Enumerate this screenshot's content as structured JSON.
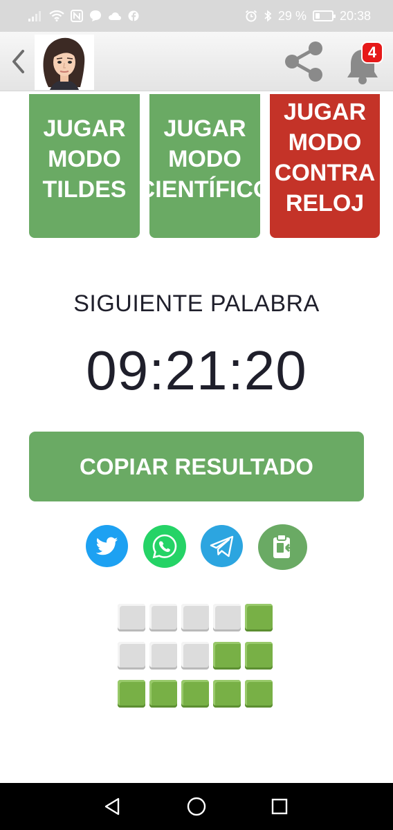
{
  "status_bar": {
    "battery_percent": "29 %",
    "battery_level": 0.29,
    "time": "20:38",
    "left_icons": [
      "signal-icon",
      "wifi-icon",
      "nfc-icon",
      "chat-bubble-icon",
      "cloud-icon",
      "facebook-icon"
    ],
    "right_icons": [
      "alarm-icon",
      "bluetooth-icon",
      "battery-icon"
    ]
  },
  "header": {
    "back_icon": "chevron-left-icon",
    "avatar": "avatar-cartoon-woman",
    "share_icon": "share-icon",
    "bell_icon": "bell-icon",
    "notification_count": "4"
  },
  "modes": [
    {
      "lines": [
        "JUGAR",
        "MODO",
        "TILDES"
      ],
      "color": "#6aaa64"
    },
    {
      "lines": [
        "JUGAR",
        "MODO",
        "CIENTÍFICO"
      ],
      "color": "#6aaa64"
    },
    {
      "lines": [
        "JUGAR",
        "MODO",
        "CONTRA",
        "RELOJ"
      ],
      "color": "#c43328"
    }
  ],
  "countdown": {
    "label": "SIGUIENTE PALABRA",
    "time": "09:21:20"
  },
  "copy_button": {
    "label": "COPIAR RESULTADO",
    "color": "#6aaa64"
  },
  "share_buttons": [
    {
      "icon": "twitter-icon",
      "color": "#1da1f2"
    },
    {
      "icon": "whatsapp-icon",
      "color": "#25d366"
    },
    {
      "icon": "telegram-icon",
      "color": "#2ca5e0"
    },
    {
      "icon": "clipboard-copy-icon",
      "color": "#6aaa64"
    }
  ],
  "result_grid": [
    [
      "grey",
      "grey",
      "grey",
      "grey",
      "green"
    ],
    [
      "grey",
      "grey",
      "grey",
      "green",
      "green"
    ],
    [
      "green",
      "green",
      "green",
      "green",
      "green"
    ]
  ],
  "nav": {
    "icons": [
      "back-triangle-icon",
      "home-circle-icon",
      "recents-square-icon"
    ]
  },
  "colors": {
    "green": "#6aaa64",
    "red": "#c43328",
    "tile_green": "#78b046",
    "tile_grey": "#dcdcdc"
  }
}
